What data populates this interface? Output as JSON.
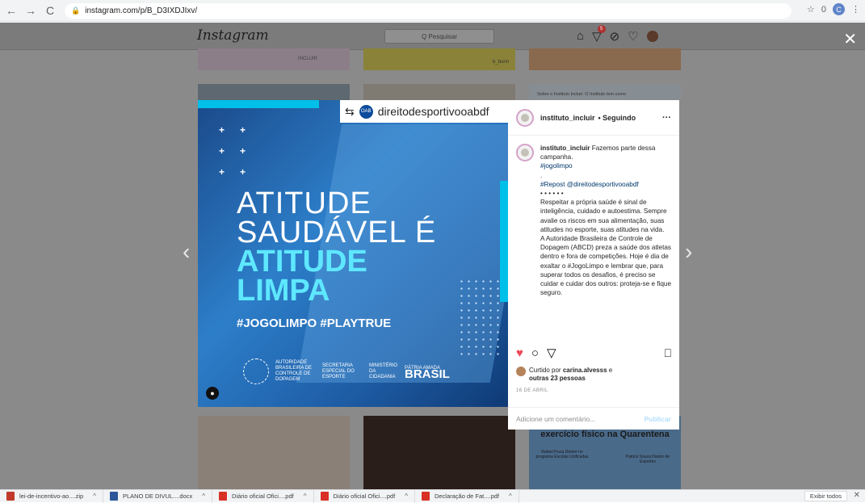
{
  "browser": {
    "back": "←",
    "forward": "→",
    "reload": "C",
    "url": "instagram.com/p/B_D3IXDJIxv/",
    "star": "☆",
    "ext": "0",
    "profile": "C",
    "menu": "⋮"
  },
  "instagram": {
    "logo": "Instagram",
    "search_placeholder": "Q  Pesquisar",
    "notif_count": "5",
    "close": "✕",
    "thumb_label_1": "INCLUIR",
    "thumb_label_2": "b_bunn",
    "thumb_text_3": "Sobre o Instituto Incluir: O Instituto tem como",
    "thumb_bottom_3": "Pessoas com Deficiência e o exercício físico na Quarentena",
    "thumb_bottom_3_p1": "Rafael Fiuza Diretor no programa Escolas Unificadas",
    "thumb_bottom_3_p2": "Patrick Souza Diretor de Esportes"
  },
  "post": {
    "repost_handle": "direitodesportivooabdf",
    "headline_1": "ATITUDE",
    "headline_2": "SAUDÁVEL É",
    "headline_3": "ATITUDE",
    "headline_4": "LIMPA",
    "hashtags": "#JOGOLIMPO  #PLAYTRUE",
    "abcd_text": "AUTORIDADE BRASILEIRA DE CONTROLE DE DOPAGEM",
    "secretaria": "SECRETARIA ESPECIAL DO ESPORTE",
    "ministerio": "MINISTÉRIO DA CIDADANIA",
    "patria": "PÁTRIA AMADA",
    "brasil": "BRASIL",
    "author": "instituto_incluir",
    "follow_state": "• Seguindo",
    "caption_user": "instituto_incluir",
    "caption_lines": [
      "Fazemos parte dessa campanha."
    ],
    "caption_tag1": "#jogolimpo",
    "caption_dot": ".",
    "caption_repost": "#Repost @direitodesportivooabdf",
    "caption_dots": "• • • • • •",
    "caption_p1": "Respeitar a própria saúde é sinal de inteligência, cuidado e autoestima. Sempre avalie os riscos em sua alimentação, suas atitudes no esporte, suas atitudes na vida.",
    "caption_p2": "A Autoridade Brasileira de Controle de Dopagem (ABCD) preza a saúde dos atletas dentro e fora de competições. Hoje é dia de exaltar o #JogoLimpo e lembrar que, para superar todos os desafios, é preciso se cuidar e cuidar dos outros: proteja-se e fique seguro.",
    "liked_by_prefix": "Curtido por",
    "liked_by_user": "carina.alvesss",
    "liked_by_suffix": "e",
    "liked_others": "outras 23 pessoas",
    "date": "16 DE ABRIL",
    "comment_placeholder": "Adicione um comentário...",
    "publish": "Publicar"
  },
  "downloads": [
    {
      "name": "lei-de-incentivo-ao....zip",
      "color": "#c0392b"
    },
    {
      "name": "PLANO DE DIVUL....docx",
      "color": "#2b579a"
    },
    {
      "name": "Diário oficial Ofici....pdf",
      "color": "#d93025"
    },
    {
      "name": "Diário oficial Ofici....pdf",
      "color": "#d93025"
    },
    {
      "name": "Declaração de Fat....pdf",
      "color": "#d93025"
    }
  ],
  "downloads_show_all": "Exibir todos",
  "downloads_close": "✕"
}
